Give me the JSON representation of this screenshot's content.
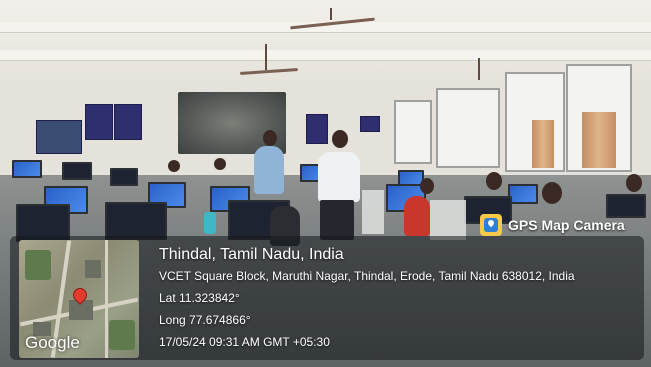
{
  "badge": {
    "label": "GPS Map Camera",
    "icon": "gps-map-camera-icon"
  },
  "location": {
    "title": "Thindal, Tamil Nadu, India",
    "address": "VCET Square Block, Maruthi Nagar, Thindal, Erode, Tamil Nadu 638012, India",
    "lat": "Lat 11.323842°",
    "long": "Long 77.674866°",
    "datetime": "17/05/24 09:31 AM GMT +05:30"
  },
  "map": {
    "watermark": "Google",
    "pin_color": "#e33b2e"
  },
  "colors": {
    "overlay": "#14181c",
    "badge_icon": "#f7c948",
    "monitor_screen": "#3a78dc"
  }
}
